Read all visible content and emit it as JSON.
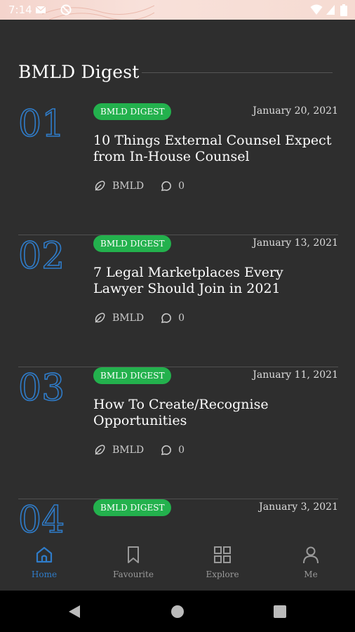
{
  "status_bar": {
    "time": "7:14"
  },
  "section": {
    "title": "BMLD Digest"
  },
  "posts": [
    {
      "number": "01",
      "category": "BMLD DIGEST",
      "date": "January 20, 2021",
      "title": "10 Things External Counsel Expect from In-House Counsel",
      "author": "BMLD",
      "comments": "0"
    },
    {
      "number": "02",
      "category": "BMLD DIGEST",
      "date": "January 13, 2021",
      "title": "7 Legal Marketplaces Every Lawyer Should Join in 2021",
      "author": "BMLD",
      "comments": "0"
    },
    {
      "number": "03",
      "category": "BMLD DIGEST",
      "date": "January 11, 2021",
      "title": "How To Create/Recognise Opportunities",
      "author": "BMLD",
      "comments": "0"
    },
    {
      "number": "04",
      "category": "BMLD DIGEST",
      "date": "January 3, 2021",
      "title": "",
      "author": "",
      "comments": ""
    }
  ],
  "nav": {
    "items": [
      {
        "label": "Home",
        "icon": "home-icon",
        "active": true
      },
      {
        "label": "Favourite",
        "icon": "bookmark-icon",
        "active": false
      },
      {
        "label": "Explore",
        "icon": "grid-icon",
        "active": false
      },
      {
        "label": "Me",
        "icon": "user-icon",
        "active": false
      }
    ]
  },
  "colors": {
    "accent": "#2f7cc9",
    "badge": "#23b14d",
    "background": "#2e2e2e"
  }
}
